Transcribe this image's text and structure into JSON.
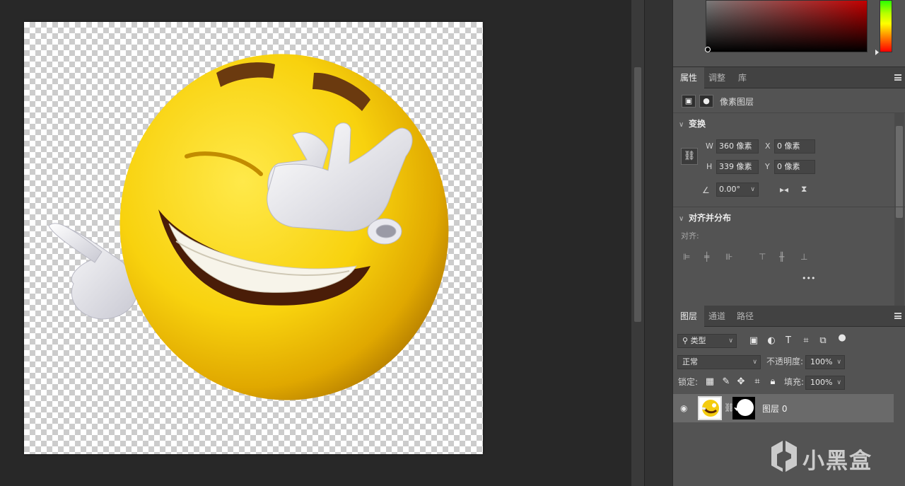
{
  "colors": {
    "accent": "#c40000",
    "panel_bg": "#535353",
    "canvas_bg": "#282828"
  },
  "properties": {
    "tabs": [
      "属性",
      "调整",
      "库"
    ],
    "active_tab": 0,
    "kind_label": "像素图层",
    "transform": {
      "title": "变换",
      "w_label": "W",
      "w_value": "360 像素",
      "h_label": "H",
      "h_value": "339 像素",
      "x_label": "X",
      "x_value": "0 像素",
      "y_label": "Y",
      "y_value": "0 像素",
      "angle_value": "0.00°"
    },
    "align": {
      "title": "对齐并分布",
      "align_label": "对齐:",
      "more": "•••"
    }
  },
  "layers": {
    "tabs": [
      "图层",
      "通道",
      "路径"
    ],
    "active_tab": 0,
    "filter_kind": "类型",
    "blend_mode": "正常",
    "opacity_label": "不透明度:",
    "opacity_value": "100%",
    "lock_label": "锁定:",
    "fill_label": "填充:",
    "fill_value": "100%",
    "items": [
      {
        "name": "图层 0",
        "visible": true,
        "has_mask": true
      }
    ]
  },
  "watermark": {
    "text": "小黑盒"
  },
  "icons": [
    "visibility-eye-icon",
    "link-chain-icon",
    "image-icon",
    "mask-icon",
    "search-icon",
    "panel-menu-icon",
    "flip-horizontal-icon",
    "flip-vertical-icon",
    "angle-icon",
    "lock-icon"
  ]
}
